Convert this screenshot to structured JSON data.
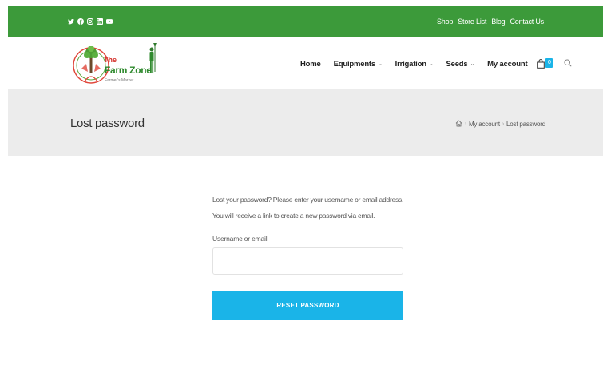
{
  "topbar": {
    "social_icons": [
      "twitter-icon",
      "facebook-icon",
      "instagram-icon",
      "linkedin-icon",
      "youtube-icon"
    ],
    "links": [
      "Shop",
      "Store List",
      "Blog",
      "Contact Us"
    ],
    "bg_color": "#3c9a3a"
  },
  "logo": {
    "line1": "The",
    "line2": "Farm Zone",
    "line3": "Farmer's Market"
  },
  "nav": {
    "items": [
      {
        "label": "Home",
        "dropdown": false
      },
      {
        "label": "Equipments",
        "dropdown": true
      },
      {
        "label": "Irrigation",
        "dropdown": true
      },
      {
        "label": "Seeds",
        "dropdown": true
      },
      {
        "label": "My account",
        "dropdown": false
      }
    ],
    "cart_count": "0"
  },
  "page": {
    "title": "Lost password",
    "breadcrumb": [
      "My account",
      "Lost password"
    ]
  },
  "form": {
    "intro": "Lost your password? Please enter your username or email address. You will receive a link to create a new password via email.",
    "username_label": "Username or email",
    "username_value": "",
    "submit_label": "RESET PASSWORD",
    "accent_color": "#1ab4e8"
  }
}
